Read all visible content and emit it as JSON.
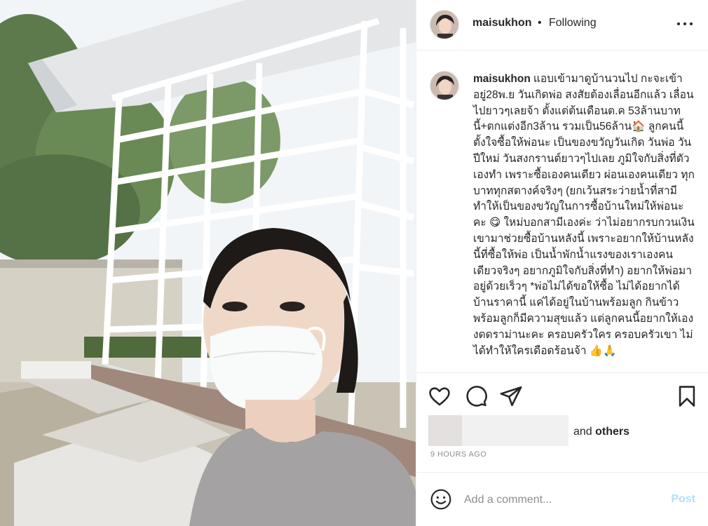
{
  "post": {
    "image_alt": "Selfie of a woman in a white face mask in front of a white steel frame structure"
  },
  "header": {
    "username": "maisukhon",
    "separator": "•",
    "follow_status": "Following",
    "more_icon": "more-horizontal-icon"
  },
  "caption": {
    "username": "maisukhon",
    "text": "แอบเข้ามาดูบ้านวนไป กะจะเข้าอยู่28พ.ย วันเกิดพ่อ สงสัยต้องเลื่อนอีกแล้ว เลื่อนไปยาวๆเลยจ้า ตั้งแต่ต้นเดือนต.ค 53ล้านบาทนี้+ตกแต่งอีก3ล้าน รวมเป็น56ล้าน🏠 ลูกคนนี้ตั้งใจซื้อให้พ่อนะ เป็นของขวัญวันเกิด วันพ่อ วันปีใหม่ วันสงกรานต์ยาวๆไปเลย ภูมิใจกับสิ่งที่ตัวเองทำ เพราะซื้อเองคนเดียว ผ่อนเองคนเดียว ทุกบาททุกสตางค์จริงๆ (ยกเว้นสระว่ายน้ำที่สามีทำให้เป็นของขวัญในการซื้อบ้านใหม่ให้พ่อนะคะ 😋 ใหม่บอกสามีเองค่ะ ว่าไม่อยากรบกวนเงินเขามาช่วยซื้อบ้านหลังนี้ เพราะอยากให้บ้านหลังนี้ที่ซื้อให้พ่อ เป็นน้ำพักน้ำแรงของเราเองคนเดียวจริงๆ อยากภูมิใจกับสิ่งที่ทำ) อยากให้พ่อมาอยู่ด้วยเร็วๆ *พ่อไม่ได้ขอให้ซื้อ ไม่ได้อยากได้บ้านราคานี้ แค่ได้อยู่ในบ้านพร้อมลูก กินข้าวพร้อมลูกก็มีความสุขแล้ว แต่ลูกคนนี้อยากให้เอง งดดราม่านะคะ ครอบครัวใคร ครอบครัวเขา ไม่ได้ทำให้ใครเดือดร้อนจ้า 👍🙏"
  },
  "actions": {
    "like_icon": "heart-icon",
    "comment_icon": "comment-bubble-icon",
    "share_icon": "send-icon",
    "save_icon": "bookmark-icon"
  },
  "likes": {
    "suffix_and": "and",
    "suffix_others": "others"
  },
  "timestamp": "9 HOURS AGO",
  "comment_box": {
    "emoji_icon": "emoji-smile-icon",
    "placeholder": "Add a comment...",
    "post_label": "Post"
  },
  "colors": {
    "text": "#262626",
    "muted": "#8e8e8e",
    "border": "#efefef",
    "post_disabled": "#b2dffc"
  }
}
